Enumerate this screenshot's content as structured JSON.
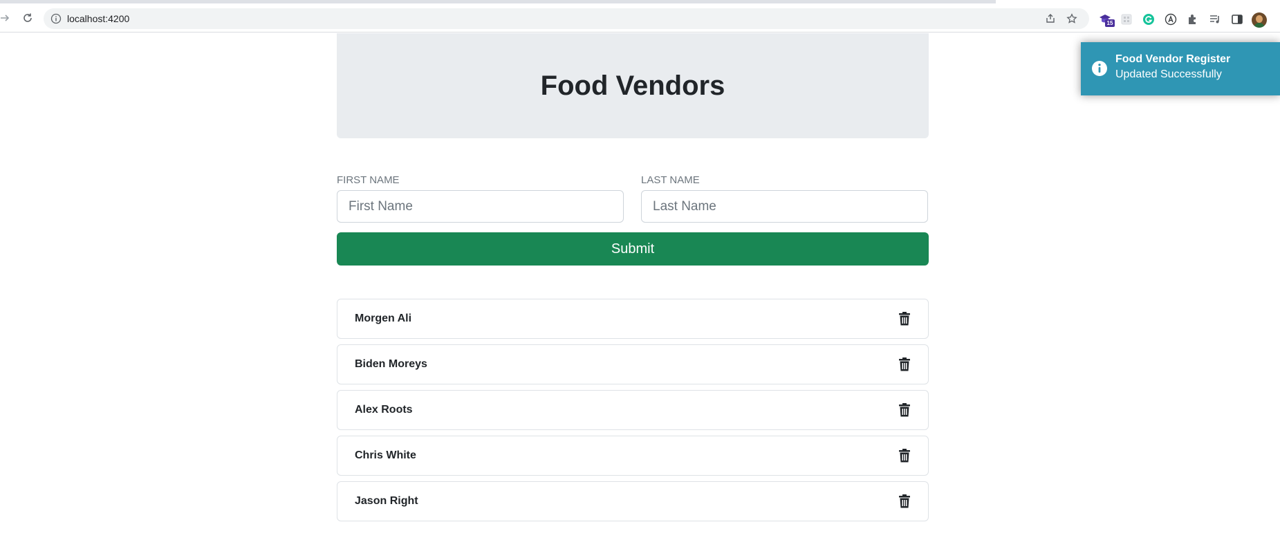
{
  "browser": {
    "url": "localhost:4200",
    "extension_badge": "15"
  },
  "header": {
    "title": "Food Vendors"
  },
  "form": {
    "first_name": {
      "label": "FIRST NAME",
      "placeholder": "First Name",
      "value": ""
    },
    "last_name": {
      "label": "LAST NAME",
      "placeholder": "Last Name",
      "value": ""
    },
    "submit_label": "Submit"
  },
  "vendors": [
    {
      "name": "Morgen Ali"
    },
    {
      "name": "Biden Moreys"
    },
    {
      "name": "Alex Roots"
    },
    {
      "name": "Chris White"
    },
    {
      "name": "Jason Right"
    }
  ],
  "toast": {
    "title": "Food Vendor Register",
    "message": "Updated Successfully"
  },
  "icons": {
    "delete": "trash-icon",
    "toast": "info-icon"
  },
  "colors": {
    "submit": "#198754",
    "toast": "#2f96b4",
    "jumbotron": "#e9ecef"
  }
}
